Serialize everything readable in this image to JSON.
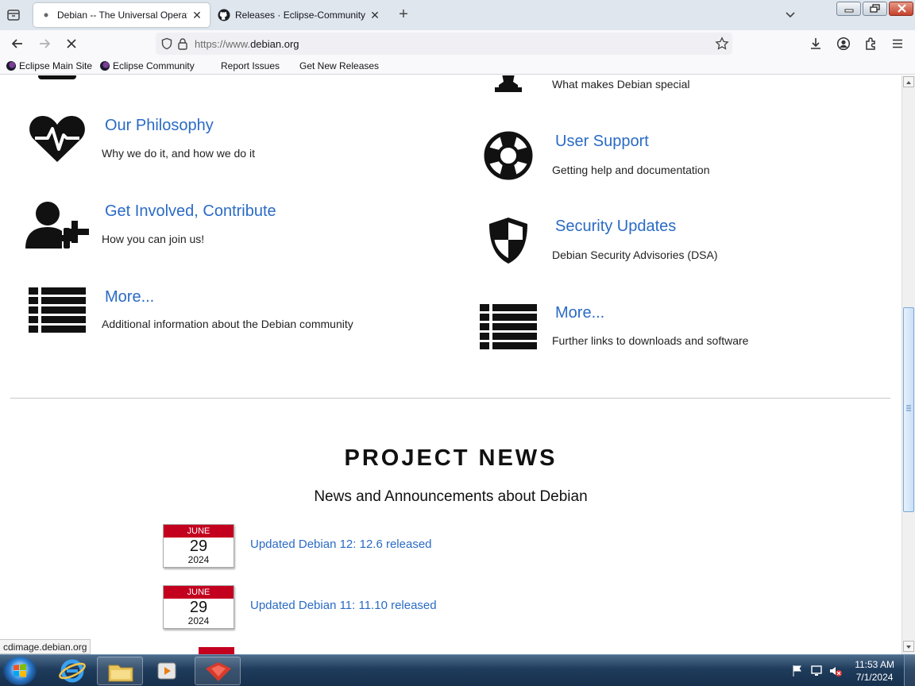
{
  "browser": {
    "tabs": [
      {
        "title": "Debian -- The Universal Operati",
        "active": true
      },
      {
        "title": "Releases · Eclipse-Community/",
        "active": false
      }
    ],
    "url_prefix": "https://www.",
    "url_domain": "debian.org",
    "bookmarks": [
      "Eclipse Main Site",
      "Eclipse Community",
      "Report Issues",
      "Get New Releases"
    ]
  },
  "page": {
    "features_left": [
      {
        "title": "Our Philosophy",
        "desc": "Why we do it, and how we do it",
        "icon": "heartbeat-icon"
      },
      {
        "title": "Get Involved, Contribute",
        "desc": "How you can join us!",
        "icon": "user-plus-icon"
      },
      {
        "title": "More...",
        "desc": "Additional information about the Debian community",
        "icon": "list-icon"
      }
    ],
    "features_right": [
      {
        "title": "",
        "desc": "What makes Debian special",
        "icon": "chess-icon"
      },
      {
        "title": "User Support",
        "desc": "Getting help and documentation",
        "icon": "lifebuoy-icon"
      },
      {
        "title": "Security Updates",
        "desc": "Debian Security Advisories (DSA)",
        "icon": "shield-icon"
      },
      {
        "title": "More...",
        "desc": "Further links to downloads and software",
        "icon": "list-icon"
      }
    ],
    "news_heading": "PROJECT NEWS",
    "news_subheading": "News and Announcements about Debian",
    "news": [
      {
        "month": "JUNE",
        "day": "29",
        "year": "2024",
        "title": "Updated Debian 12: 12.6 released"
      },
      {
        "month": "JUNE",
        "day": "29",
        "year": "2024",
        "title": "Updated Debian 11: 11.10 released"
      }
    ]
  },
  "status_text": "cdimage.debian.org",
  "taskbar": {
    "time": "11:53 AM",
    "date": "7/1/2024"
  },
  "colors": {
    "link": "#2a6bc5",
    "calendar_red": "#c4001f"
  }
}
